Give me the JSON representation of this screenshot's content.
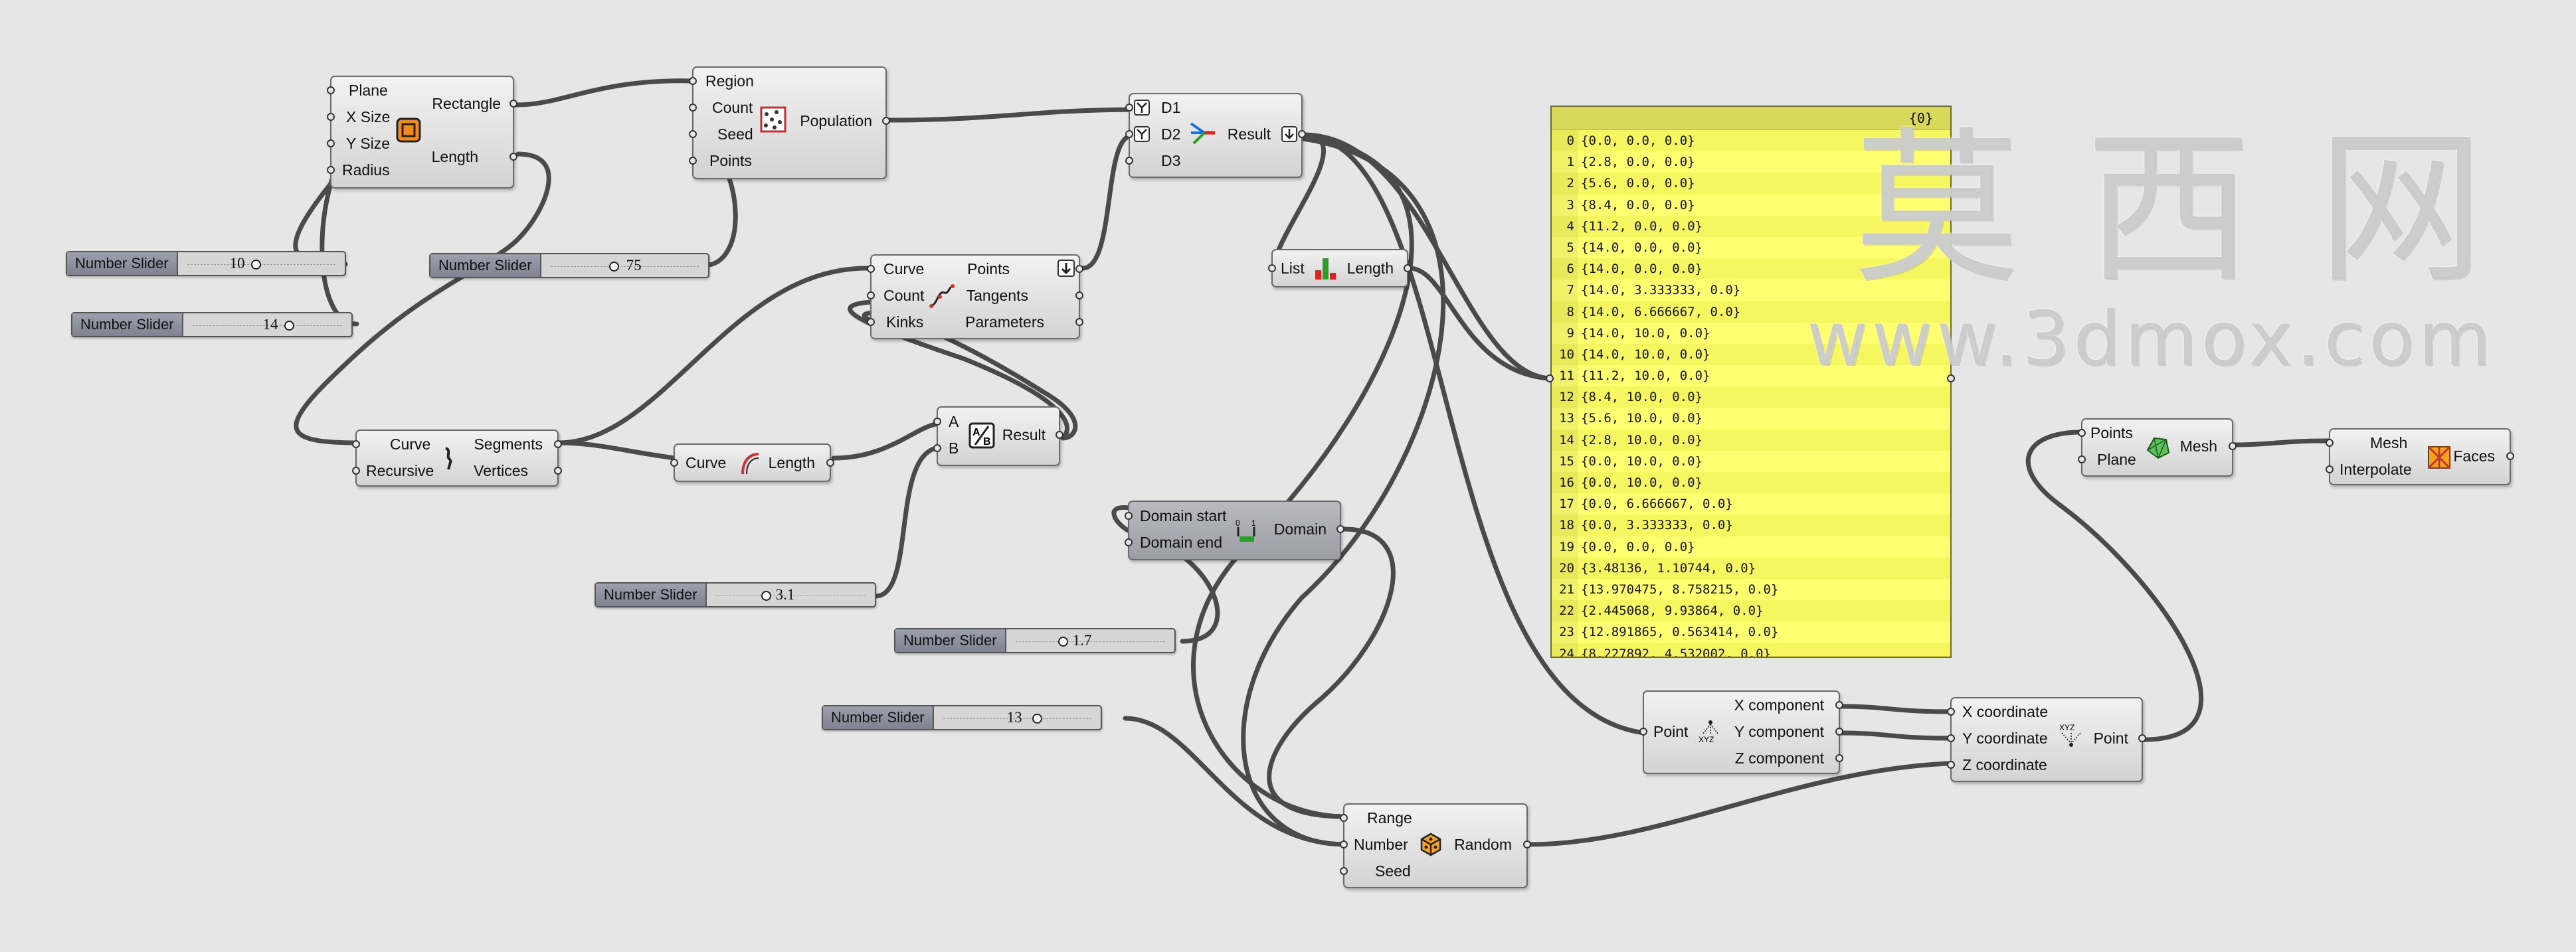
{
  "canvas": {
    "background": "#e6e6e6"
  },
  "rectangle": {
    "in_plane": "Plane",
    "in_xsize": "X Size",
    "in_ysize": "Y Size",
    "in_radius": "Radius",
    "out_rect": "Rectangle",
    "out_len": "Length",
    "icon": "rectangle-icon"
  },
  "population": {
    "in_region": "Region",
    "in_count": "Count",
    "in_seed": "Seed",
    "in_points": "Points",
    "out": "Population",
    "icon": "population-icon"
  },
  "sliders": [
    {
      "name": "Number Slider",
      "value": "10"
    },
    {
      "name": "Number Slider",
      "value": "14"
    },
    {
      "name": "Number Slider",
      "value": "75"
    },
    {
      "name": "Number Slider",
      "value": "3.1"
    },
    {
      "name": "Number Slider",
      "value": "1.7"
    },
    {
      "name": "Number Slider",
      "value": "13"
    }
  ],
  "divide_curve": {
    "in_curve": "Curve",
    "in_count": "Count",
    "in_kinks": "Kinks",
    "out_points": "Points",
    "out_tangents": "Tangents",
    "out_params": "Parameters",
    "icon": "divide-curve-icon"
  },
  "explode": {
    "in_curve": "Curve",
    "in_recursive": "Recursive",
    "out_segments": "Segments",
    "out_vertices": "Vertices",
    "icon": "explode-icon"
  },
  "length": {
    "in_curve": "Curve",
    "out": "Length",
    "icon": "curve-length-icon"
  },
  "division": {
    "in_a": "A",
    "in_b": "B",
    "out": "Result",
    "icon": "division-icon"
  },
  "merge": {
    "in_d1": "D1",
    "in_d2": "D2",
    "in_d3": "D3",
    "out": "Result",
    "icon": "merge-icon"
  },
  "list_length": {
    "in": "List",
    "out": "Length",
    "icon": "list-length-icon"
  },
  "domain": {
    "in_start": "Domain start",
    "in_end": "Domain end",
    "out": "Domain",
    "icon": "domain-icon"
  },
  "panel": {
    "header": "{0}",
    "rows": [
      {
        "i": "0",
        "v": "{0.0, 0.0, 0.0}"
      },
      {
        "i": "1",
        "v": "{2.8, 0.0, 0.0}"
      },
      {
        "i": "2",
        "v": "{5.6, 0.0, 0.0}"
      },
      {
        "i": "3",
        "v": "{8.4, 0.0, 0.0}"
      },
      {
        "i": "4",
        "v": "{11.2, 0.0, 0.0}"
      },
      {
        "i": "5",
        "v": "{14.0, 0.0, 0.0}"
      },
      {
        "i": "6",
        "v": "{14.0, 0.0, 0.0}"
      },
      {
        "i": "7",
        "v": "{14.0, 3.333333, 0.0}"
      },
      {
        "i": "8",
        "v": "{14.0, 6.666667, 0.0}"
      },
      {
        "i": "9",
        "v": "{14.0, 10.0, 0.0}"
      },
      {
        "i": "10",
        "v": "{14.0, 10.0, 0.0}"
      },
      {
        "i": "11",
        "v": "{11.2, 10.0, 0.0}"
      },
      {
        "i": "12",
        "v": "{8.4, 10.0, 0.0}"
      },
      {
        "i": "13",
        "v": "{5.6, 10.0, 0.0}"
      },
      {
        "i": "14",
        "v": "{2.8, 10.0, 0.0}"
      },
      {
        "i": "15",
        "v": "{0.0, 10.0, 0.0}"
      },
      {
        "i": "16",
        "v": "{0.0, 10.0, 0.0}"
      },
      {
        "i": "17",
        "v": "{0.0, 6.666667, 0.0}"
      },
      {
        "i": "18",
        "v": "{0.0, 3.333333, 0.0}"
      },
      {
        "i": "19",
        "v": "{0.0, 0.0, 0.0}"
      },
      {
        "i": "20",
        "v": "{3.48136, 1.10744, 0.0}"
      },
      {
        "i": "21",
        "v": "{13.970475, 8.758215, 0.0}"
      },
      {
        "i": "22",
        "v": "{2.445068, 9.93864, 0.0}"
      },
      {
        "i": "23",
        "v": "{12.891865, 0.563414, 0.0}"
      },
      {
        "i": "24",
        "v": "{8.227892, 4.532002, 0.0}"
      }
    ],
    "color": "#ffff70"
  },
  "deconstruct": {
    "in": "Point",
    "out_x": "X component",
    "out_y": "Y component",
    "out_z": "Z component",
    "icon": "deconstruct-point-icon"
  },
  "construct": {
    "in_x": "X coordinate",
    "in_y": "Y coordinate",
    "in_z": "Z coordinate",
    "out": "Point",
    "icon": "construct-point-icon"
  },
  "random": {
    "in_range": "Range",
    "in_number": "Number",
    "in_seed": "Seed",
    "out": "Random",
    "icon": "random-icon"
  },
  "delaunay": {
    "in_points": "Points",
    "in_plane": "Plane",
    "out": "Mesh",
    "icon": "delaunay-mesh-icon"
  },
  "faces": {
    "in_mesh": "Mesh",
    "in_interp": "Interpolate",
    "out": "Faces",
    "icon": "face-boundaries-icon"
  },
  "watermark": {
    "cn": "莫 西 网",
    "url": "www.3dmox.com"
  }
}
